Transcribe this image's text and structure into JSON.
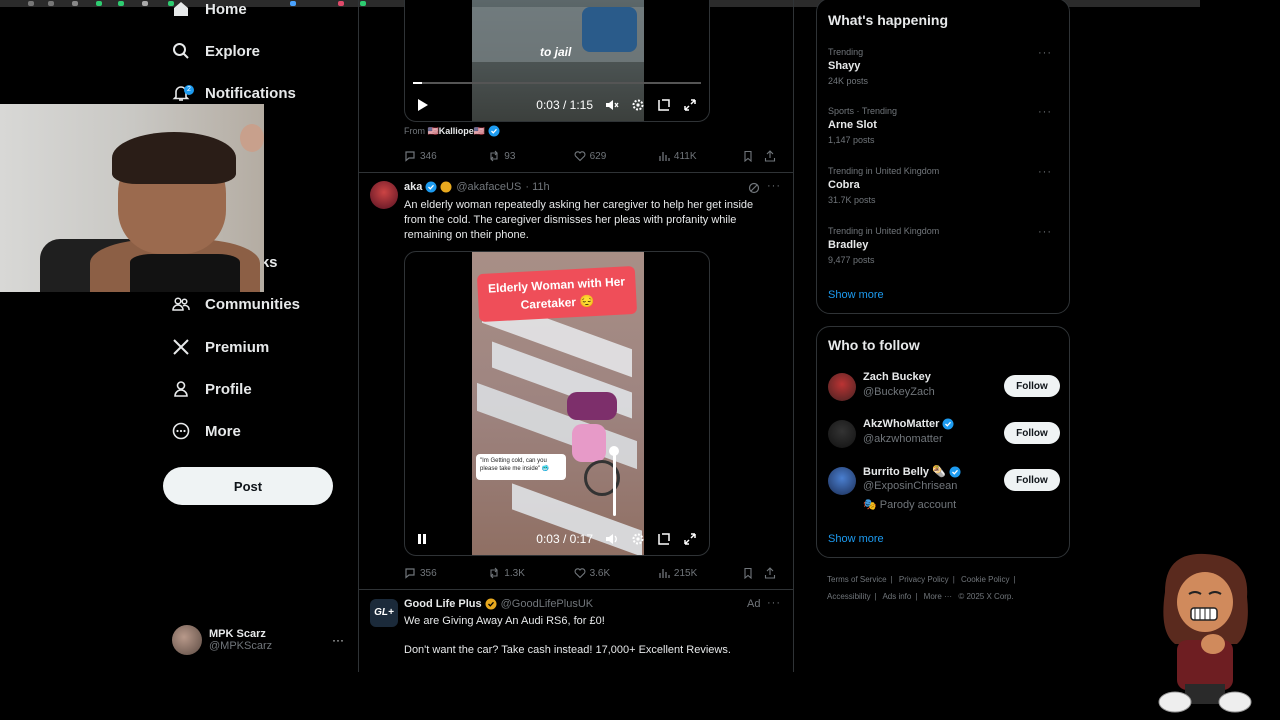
{
  "nav": {
    "home": "Home",
    "explore": "Explore",
    "notifications": "Notifications",
    "notifications_badge": "2",
    "bookmarks_partial": "rks",
    "communities": "Communities",
    "premium": "Premium",
    "profile": "Profile",
    "more": "More",
    "post": "Post"
  },
  "account": {
    "display_name": "MPK Scarz",
    "handle": "@MPKScarz"
  },
  "tweet1": {
    "caption": "to jail",
    "time": "0:03 / 1:15",
    "from_label": "From",
    "from_name": "🇺🇸Kalliope🇺🇸",
    "replies": "346",
    "reposts": "93",
    "likes": "629",
    "views": "411K"
  },
  "tweet2": {
    "display_name": "aka",
    "handle": "@akafaceUS",
    "age": "· 11h",
    "text": "An elderly woman repeatedly asking her caregiver to help her get inside from the cold. The caregiver dismisses her pleas with profanity while remaining on their phone.",
    "overlay_title": "Elderly Woman with Her Caretaker 😔",
    "overlay_quote": "\"Im Getting cold, can you please take me inside\" 🥶",
    "time": "0:03 / 0:17",
    "replies": "356",
    "reposts": "1.3K",
    "likes": "3.6K",
    "views": "215K"
  },
  "tweet3": {
    "display_name": "Good Life Plus",
    "handle": "@GoodLifePlusUK",
    "ad_label": "Ad",
    "avatar_text": "GL+",
    "line1": "We are Giving Away An Audi RS6, for £0!",
    "line2": "Don't want the car? Take cash instead! 17,000+ Excellent Reviews."
  },
  "trends": {
    "title": "What's happening",
    "items": [
      {
        "meta": "Trending",
        "name": "Shayy",
        "count": "24K posts"
      },
      {
        "meta": "Sports · Trending",
        "name": "Arne Slot",
        "count": "1,147 posts"
      },
      {
        "meta": "Trending in United Kingdom",
        "name": "Cobra",
        "count": "31.7K posts"
      },
      {
        "meta": "Trending in United Kingdom",
        "name": "Bradley",
        "count": "9,477 posts"
      }
    ],
    "show_more": "Show more"
  },
  "who_to_follow": {
    "title": "Who to follow",
    "users": [
      {
        "name": "Zach Buckey",
        "handle": "@BuckeyZach",
        "button": "Follow"
      },
      {
        "name": "AkzWhoMatter",
        "handle": "@akzwhomatter",
        "button": "Follow"
      },
      {
        "name": "Burrito Belly 🌯",
        "handle": "@ExposinChrisean",
        "button": "Follow",
        "note": "Parody account"
      }
    ],
    "show_more": "Show more"
  },
  "footer": {
    "terms": "Terms of Service",
    "privacy": "Privacy Policy",
    "cookies": "Cookie Policy",
    "accessibility": "Accessibility",
    "ads": "Ads info",
    "more": "More ···",
    "copyright": "© 2025 X Corp."
  },
  "colors": {
    "accent": "#1d9bf0",
    "background": "#000000",
    "text": "#e7e9ea",
    "muted": "#71767b",
    "border": "#2f3336",
    "overlay_red": "#ef4e59"
  }
}
